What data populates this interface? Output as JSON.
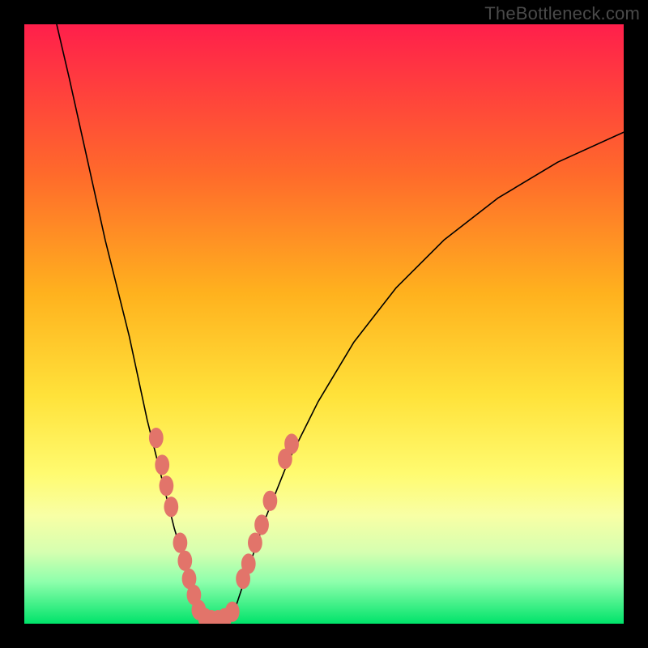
{
  "watermark": "TheBottleneck.com",
  "chart_data": {
    "type": "line",
    "title": "",
    "xlabel": "",
    "ylabel": "",
    "xlim": [
      0,
      100
    ],
    "ylim": [
      0,
      100
    ],
    "note": "V-shaped bottleneck curve over a vertical red→orange→yellow→green gradient. Salmon-colored markers cluster along the lower legs of the V. Values below are estimated from the rendered pixels (no axes/ticks present).",
    "gradient_stops": [
      {
        "offset": 0,
        "color": "#ff1f4b"
      },
      {
        "offset": 25,
        "color": "#ff6a2b"
      },
      {
        "offset": 45,
        "color": "#ffb21e"
      },
      {
        "offset": 62,
        "color": "#ffe23a"
      },
      {
        "offset": 75,
        "color": "#fffb70"
      },
      {
        "offset": 82,
        "color": "#f8ffa5"
      },
      {
        "offset": 88,
        "color": "#d6ffb0"
      },
      {
        "offset": 93,
        "color": "#8effac"
      },
      {
        "offset": 100,
        "color": "#00e36a"
      }
    ],
    "series": [
      {
        "name": "left-leg",
        "x": [
          5.4,
          7.5,
          9.5,
          11.5,
          13.5,
          15.5,
          17.5,
          19.0,
          20.5,
          22.0,
          23.5,
          25.0,
          26.5,
          28.0,
          29.2
        ],
        "y": [
          100,
          91,
          82,
          73,
          64,
          56,
          48,
          41,
          34,
          28,
          22,
          16,
          11,
          6,
          2
        ]
      },
      {
        "name": "trough",
        "x": [
          29.2,
          30.0,
          31.0,
          32.0,
          33.0,
          34.0,
          35.0
        ],
        "y": [
          2,
          1,
          0.6,
          0.5,
          0.6,
          1,
          2
        ]
      },
      {
        "name": "right-leg",
        "x": [
          35.0,
          37.0,
          40.0,
          44.0,
          49.0,
          55.0,
          62.0,
          70.0,
          79.0,
          89.0,
          100.0
        ],
        "y": [
          2,
          8,
          17,
          27,
          37,
          47,
          56,
          64,
          71,
          77,
          82
        ]
      }
    ],
    "markers": {
      "color": "#e2746a",
      "rx": 1.2,
      "ry": 1.7,
      "points": [
        {
          "x": 22.0,
          "y": 31.0
        },
        {
          "x": 23.0,
          "y": 26.5
        },
        {
          "x": 23.7,
          "y": 23.0
        },
        {
          "x": 24.5,
          "y": 19.5
        },
        {
          "x": 26.0,
          "y": 13.5
        },
        {
          "x": 26.8,
          "y": 10.5
        },
        {
          "x": 27.5,
          "y": 7.5
        },
        {
          "x": 28.3,
          "y": 4.8
        },
        {
          "x": 29.1,
          "y": 2.3
        },
        {
          "x": 30.2,
          "y": 0.9
        },
        {
          "x": 31.2,
          "y": 0.6
        },
        {
          "x": 32.3,
          "y": 0.6
        },
        {
          "x": 33.4,
          "y": 0.9
        },
        {
          "x": 34.7,
          "y": 2.0
        },
        {
          "x": 36.5,
          "y": 7.5
        },
        {
          "x": 37.4,
          "y": 10.0
        },
        {
          "x": 38.5,
          "y": 13.5
        },
        {
          "x": 39.6,
          "y": 16.5
        },
        {
          "x": 41.0,
          "y": 20.5
        },
        {
          "x": 43.5,
          "y": 27.5
        },
        {
          "x": 44.6,
          "y": 30.0
        }
      ]
    }
  }
}
